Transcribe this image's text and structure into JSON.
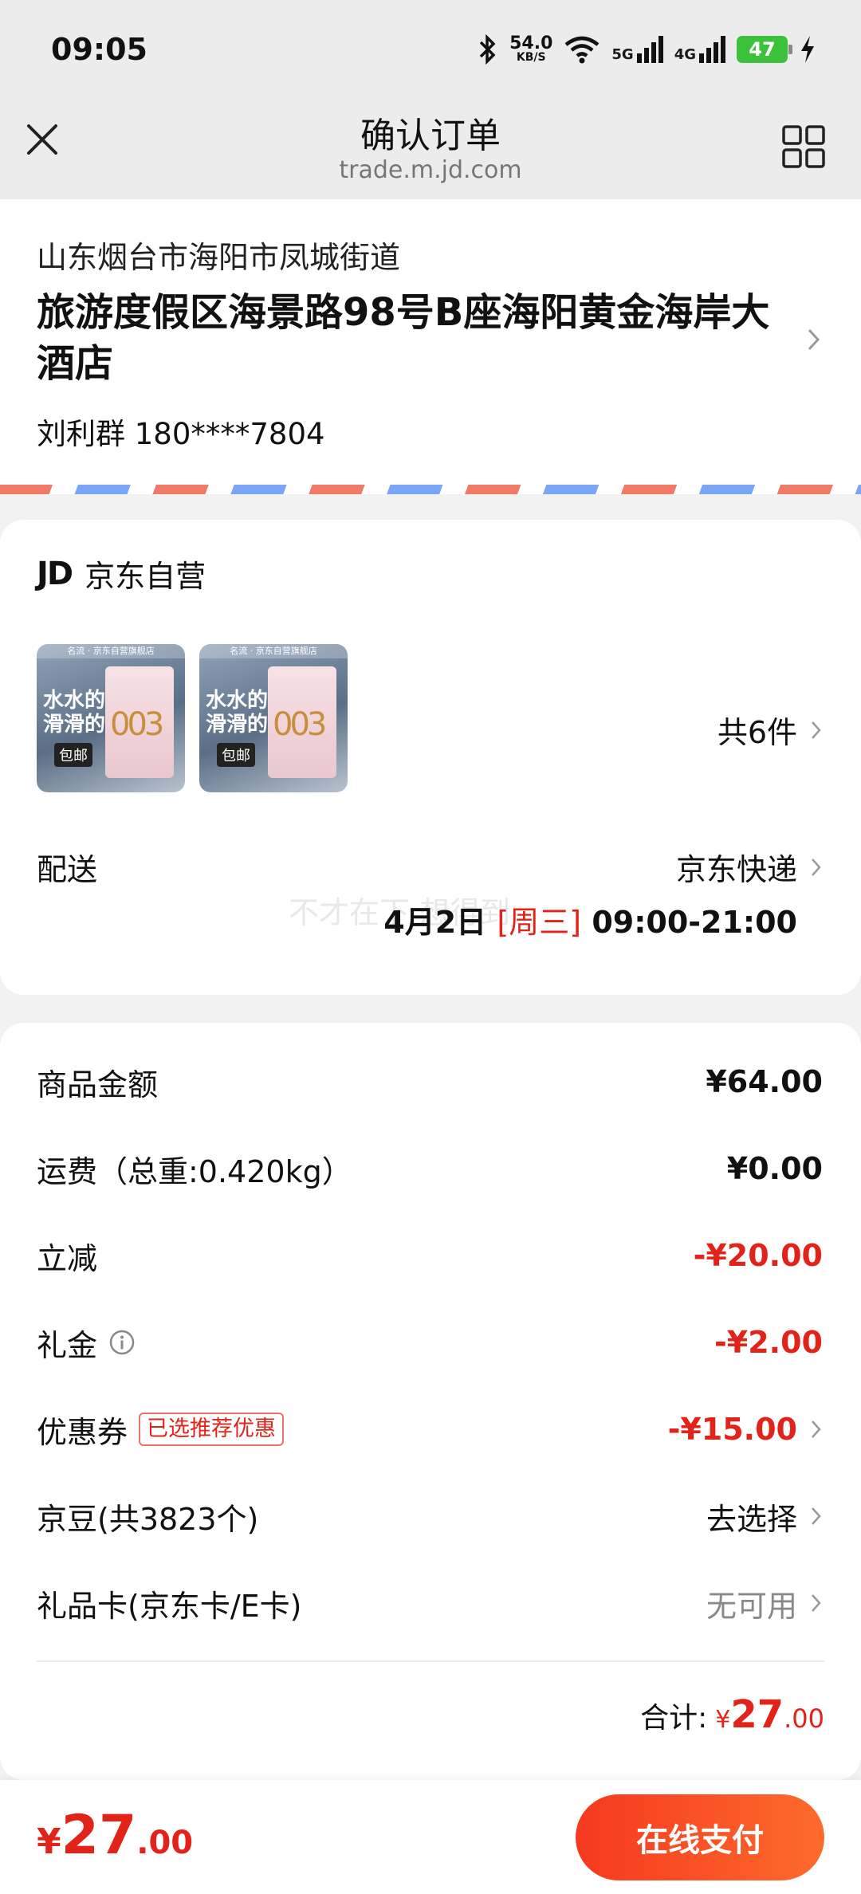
{
  "status_bar": {
    "time": "09:05",
    "net_speed_value": "54.0",
    "net_speed_unit": "KB/S",
    "signal1": "5G",
    "signal2": "4G",
    "battery": "47"
  },
  "header": {
    "title": "确认订单",
    "subtitle": "trade.m.jd.com"
  },
  "address": {
    "region": "山东烟台市海阳市凤城街道",
    "detail": "旅游度假区海景路98号B座海阳黄金海岸大酒店",
    "contact": "刘利群 180****7804"
  },
  "store": {
    "logo": "JD",
    "name": "京东自营",
    "product_thumb": {
      "top": "名流 · 京东自营旗舰店",
      "headline_1": "水水的",
      "headline_2": "滑滑的",
      "tag": "包邮",
      "brand_mark": "003"
    },
    "item_count": "共6件"
  },
  "delivery": {
    "label": "配送",
    "method": "京东快递",
    "date": "4月2日",
    "weekday": "[周三]",
    "time": "09:00-21:00",
    "watermark": "不才在下 想得到"
  },
  "price_rows": [
    {
      "label": "商品金额",
      "value": "¥64.00"
    },
    {
      "label": "运费（总重:0.420kg）",
      "value": "¥0.00"
    },
    {
      "label": "立减",
      "value": "-¥20.00"
    },
    {
      "label": "礼金",
      "value": "-¥2.00"
    },
    {
      "label": "优惠券",
      "badge": "已选推荐优惠",
      "value": "-¥15.00"
    },
    {
      "label": "京豆(共3823个)",
      "value": "去选择"
    },
    {
      "label": "礼品卡(京东卡/E卡)",
      "value": "无可用"
    }
  ],
  "total": {
    "label": "合计:",
    "currency": "¥",
    "integer": "27",
    "decimal": ".00"
  },
  "bottom_bar": {
    "currency": "¥",
    "integer": "27",
    "decimal": ".00",
    "pay_label": "在线支付"
  },
  "colors": {
    "accent_red": "#e2231a",
    "pay_gradient_start": "#f6391f",
    "pay_gradient_end": "#fd6b2c"
  }
}
